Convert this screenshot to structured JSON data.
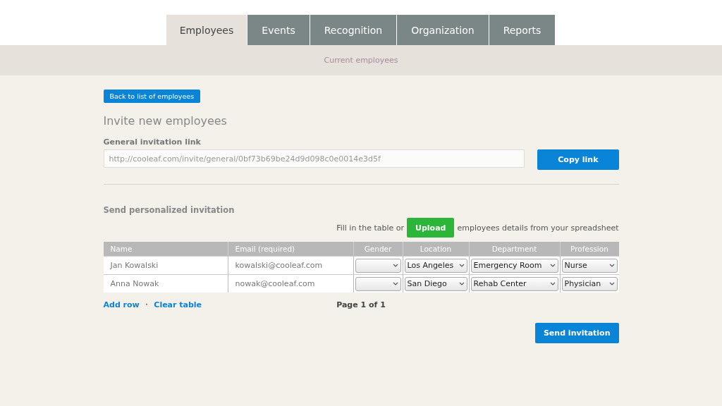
{
  "tabs": [
    {
      "label": "Employees",
      "selected": true
    },
    {
      "label": "Events",
      "selected": false
    },
    {
      "label": "Recognition",
      "selected": false
    },
    {
      "label": "Organization",
      "selected": false
    },
    {
      "label": "Reports",
      "selected": false
    }
  ],
  "subnav": {
    "label": "Current employees"
  },
  "back_button": "Back to list of employees",
  "heading": "Invite new employees",
  "general_link": {
    "label": "General invitation link",
    "value": "http://cooleaf.com/invite/general/0bf73b69be24d9d098c0e0014e3d5f",
    "button": "Copy link"
  },
  "personalized": {
    "heading": "Send personalized invitation",
    "prompt_before": "Fill in the table or",
    "upload_button": "Upload",
    "prompt_after": "employees details from your spreadsheet"
  },
  "table": {
    "columns": [
      "Name",
      "Email (required)",
      "Gender",
      "Location",
      "Department",
      "Profession"
    ],
    "rows": [
      {
        "name": "Jan Kowalski",
        "email": "kowalski@cooleaf.com",
        "location": "Los Angeles",
        "department": "Emergency Room",
        "profession": "Nurse"
      },
      {
        "name": "Anna Nowak",
        "email": "nowak@cooleaf.com",
        "location": "San Diego",
        "department": "Rehab Center",
        "profession": "Physician"
      }
    ]
  },
  "table_actions": {
    "add_row": "Add row",
    "separator": "·",
    "clear_table": "Clear table",
    "pagination": "Page 1 of 1"
  },
  "send_button": "Send invitation"
}
